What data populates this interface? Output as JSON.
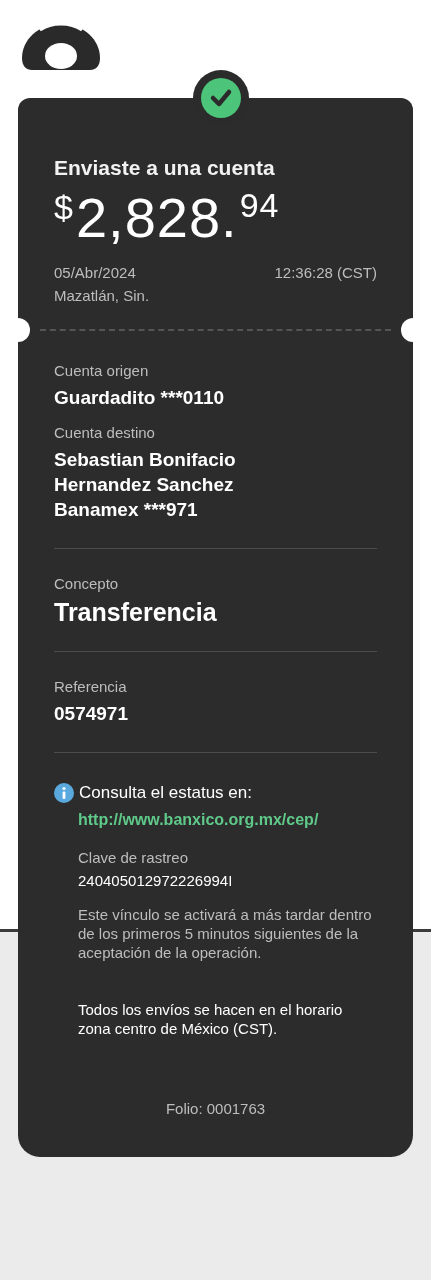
{
  "receipt": {
    "title": "Enviaste a una cuenta",
    "amount": {
      "currency": "$",
      "whole": "2,828.",
      "cents": "94"
    },
    "date": "05/Abr/2024",
    "time": "12:36:28 (CST)",
    "place": "Mazatlán, Sin."
  },
  "details": [
    {
      "label": "Cuenta origen",
      "lines": [
        "Guardadito ***0110"
      ],
      "kind": "plain"
    },
    {
      "label": "Cuenta destino",
      "lines": [
        "Sebastian Bonifacio",
        "Hernandez Sanchez",
        "Banamex ***971"
      ],
      "kind": "divided"
    },
    {
      "label": "Concepto",
      "lines": [
        "Transferencia"
      ],
      "kind": "large"
    },
    {
      "label": "Referencia",
      "lines": [
        "0574971"
      ],
      "kind": "divided"
    }
  ],
  "status_info": {
    "heading": "Consulta el estatus en:",
    "link": "http://www.banxico.org.mx/cep/",
    "tracking_label": "Clave de rastreo",
    "tracking_key": "240405012972226994I",
    "note": "Este vínculo se activará a más tardar dentro de los primeros 5 minutos siguientes de la aceptación de la operación."
  },
  "schedule_note": "Todos los envíos se hacen en el horario zona centro de México (CST).",
  "folio": "Folio: 0001763"
}
